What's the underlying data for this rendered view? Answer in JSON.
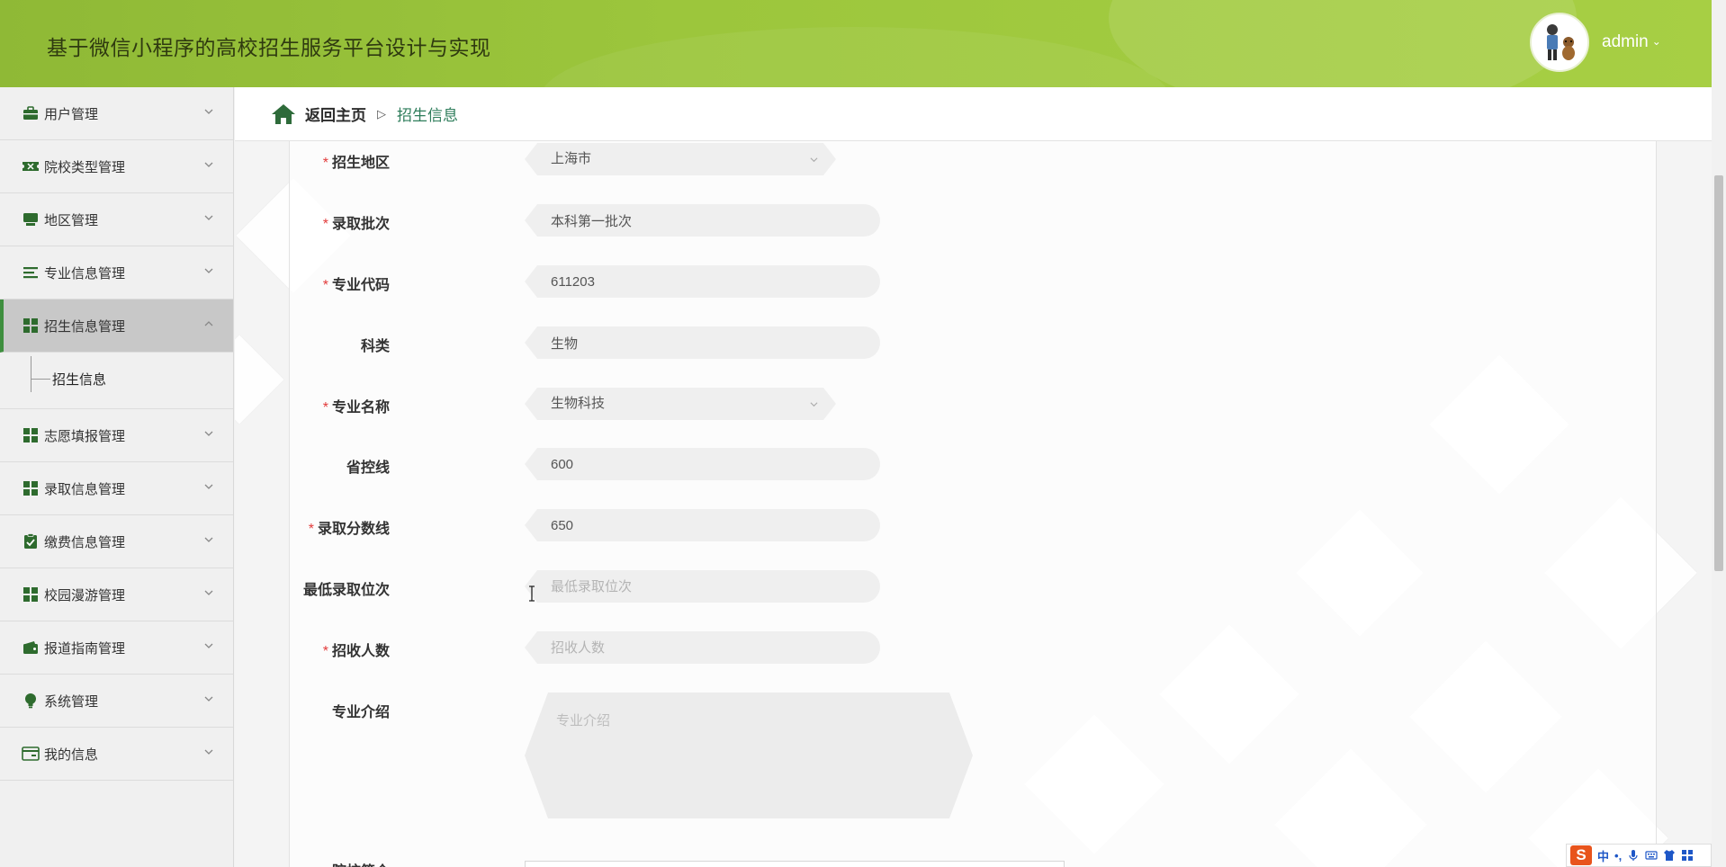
{
  "header": {
    "title": "基于微信小程序的高校招生服务平台设计与实现",
    "username": "admin"
  },
  "sidebar": {
    "items": [
      {
        "label": "用户管理",
        "icon": "briefcase-icon"
      },
      {
        "label": "院校类型管理",
        "icon": "ticket-icon"
      },
      {
        "label": "地区管理",
        "icon": "monitor-icon"
      },
      {
        "label": "专业信息管理",
        "icon": "list-icon"
      },
      {
        "label": "招生信息管理",
        "icon": "grid-icon",
        "active": true,
        "sub": [
          "招生信息"
        ]
      },
      {
        "label": "志愿填报管理",
        "icon": "grid-icon"
      },
      {
        "label": "录取信息管理",
        "icon": "grid-icon"
      },
      {
        "label": "缴费信息管理",
        "icon": "clipboard-check-icon"
      },
      {
        "label": "校园漫游管理",
        "icon": "grid-icon"
      },
      {
        "label": "报道指南管理",
        "icon": "wallet-icon"
      },
      {
        "label": "系统管理",
        "icon": "lightbulb-icon"
      },
      {
        "label": "我的信息",
        "icon": "id-card-icon"
      }
    ]
  },
  "breadcrumb": {
    "home": "返回主页",
    "separator": "▷",
    "current": "招生信息"
  },
  "form": {
    "region": {
      "label": "招生地区",
      "required": true,
      "value": "上海市"
    },
    "batch": {
      "label": "录取批次",
      "required": true,
      "value": "本科第一批次"
    },
    "major_code": {
      "label": "专业代码",
      "required": true,
      "value": "611203"
    },
    "subject": {
      "label": "科类",
      "required": false,
      "value": "生物"
    },
    "major_name": {
      "label": "专业名称",
      "required": true,
      "value": "生物科技"
    },
    "province_line": {
      "label": "省控线",
      "required": false,
      "value": "600"
    },
    "admission_score": {
      "label": "录取分数线",
      "required": true,
      "value": "650"
    },
    "min_rank": {
      "label": "最低录取位次",
      "required": false,
      "value": "",
      "placeholder": "最低录取位次"
    },
    "enroll_count": {
      "label": "招收人数",
      "required": true,
      "value": "",
      "placeholder": "招收人数"
    },
    "major_intro": {
      "label": "专业介绍",
      "required": false,
      "value": "",
      "placeholder": "专业介绍"
    },
    "school_intro": {
      "label": "院校简介"
    }
  },
  "ime": {
    "lang": "中",
    "punct": "•,"
  },
  "colors": {
    "header_green": "#9cc63c",
    "active_bar": "#3f8f3f",
    "required": "#e23b3b",
    "breadcrumb_current": "#2e7d5b"
  }
}
